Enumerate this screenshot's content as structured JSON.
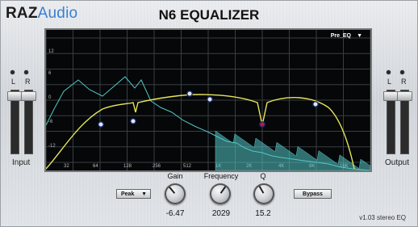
{
  "brand": {
    "part1": "RAZ",
    "part2": "Audio"
  },
  "title": "N6 EQUALIZER",
  "preset": {
    "label": "Pre_EQ",
    "arrow": "▼"
  },
  "y_ticks": [
    "12",
    "6",
    "0",
    "-6",
    "-12"
  ],
  "x_ticks": [
    "32",
    "64",
    "128",
    "256",
    "512",
    "1K",
    "2K",
    "4K",
    "8K",
    "16K"
  ],
  "input": {
    "label": "Input",
    "left": "L",
    "right": "R"
  },
  "output": {
    "label": "Output",
    "left": "L",
    "right": "R"
  },
  "filter_type": {
    "value": "Peak",
    "arrow": "▼"
  },
  "gain": {
    "label": "Gain",
    "value": "-6.47"
  },
  "frequency": {
    "label": "Frequency",
    "value": "2029"
  },
  "q": {
    "label": "Q",
    "value": "15.2"
  },
  "bypass": {
    "label": "Bypass"
  },
  "version": "v1.03 stereo EQ",
  "colors": {
    "curve": "#e8e55a",
    "spectrum": "#53c6c6",
    "selected_band": "#c2183a"
  },
  "icons": {
    "preset_arrow": "chevron-down-icon",
    "type_arrow": "chevron-down-icon"
  }
}
